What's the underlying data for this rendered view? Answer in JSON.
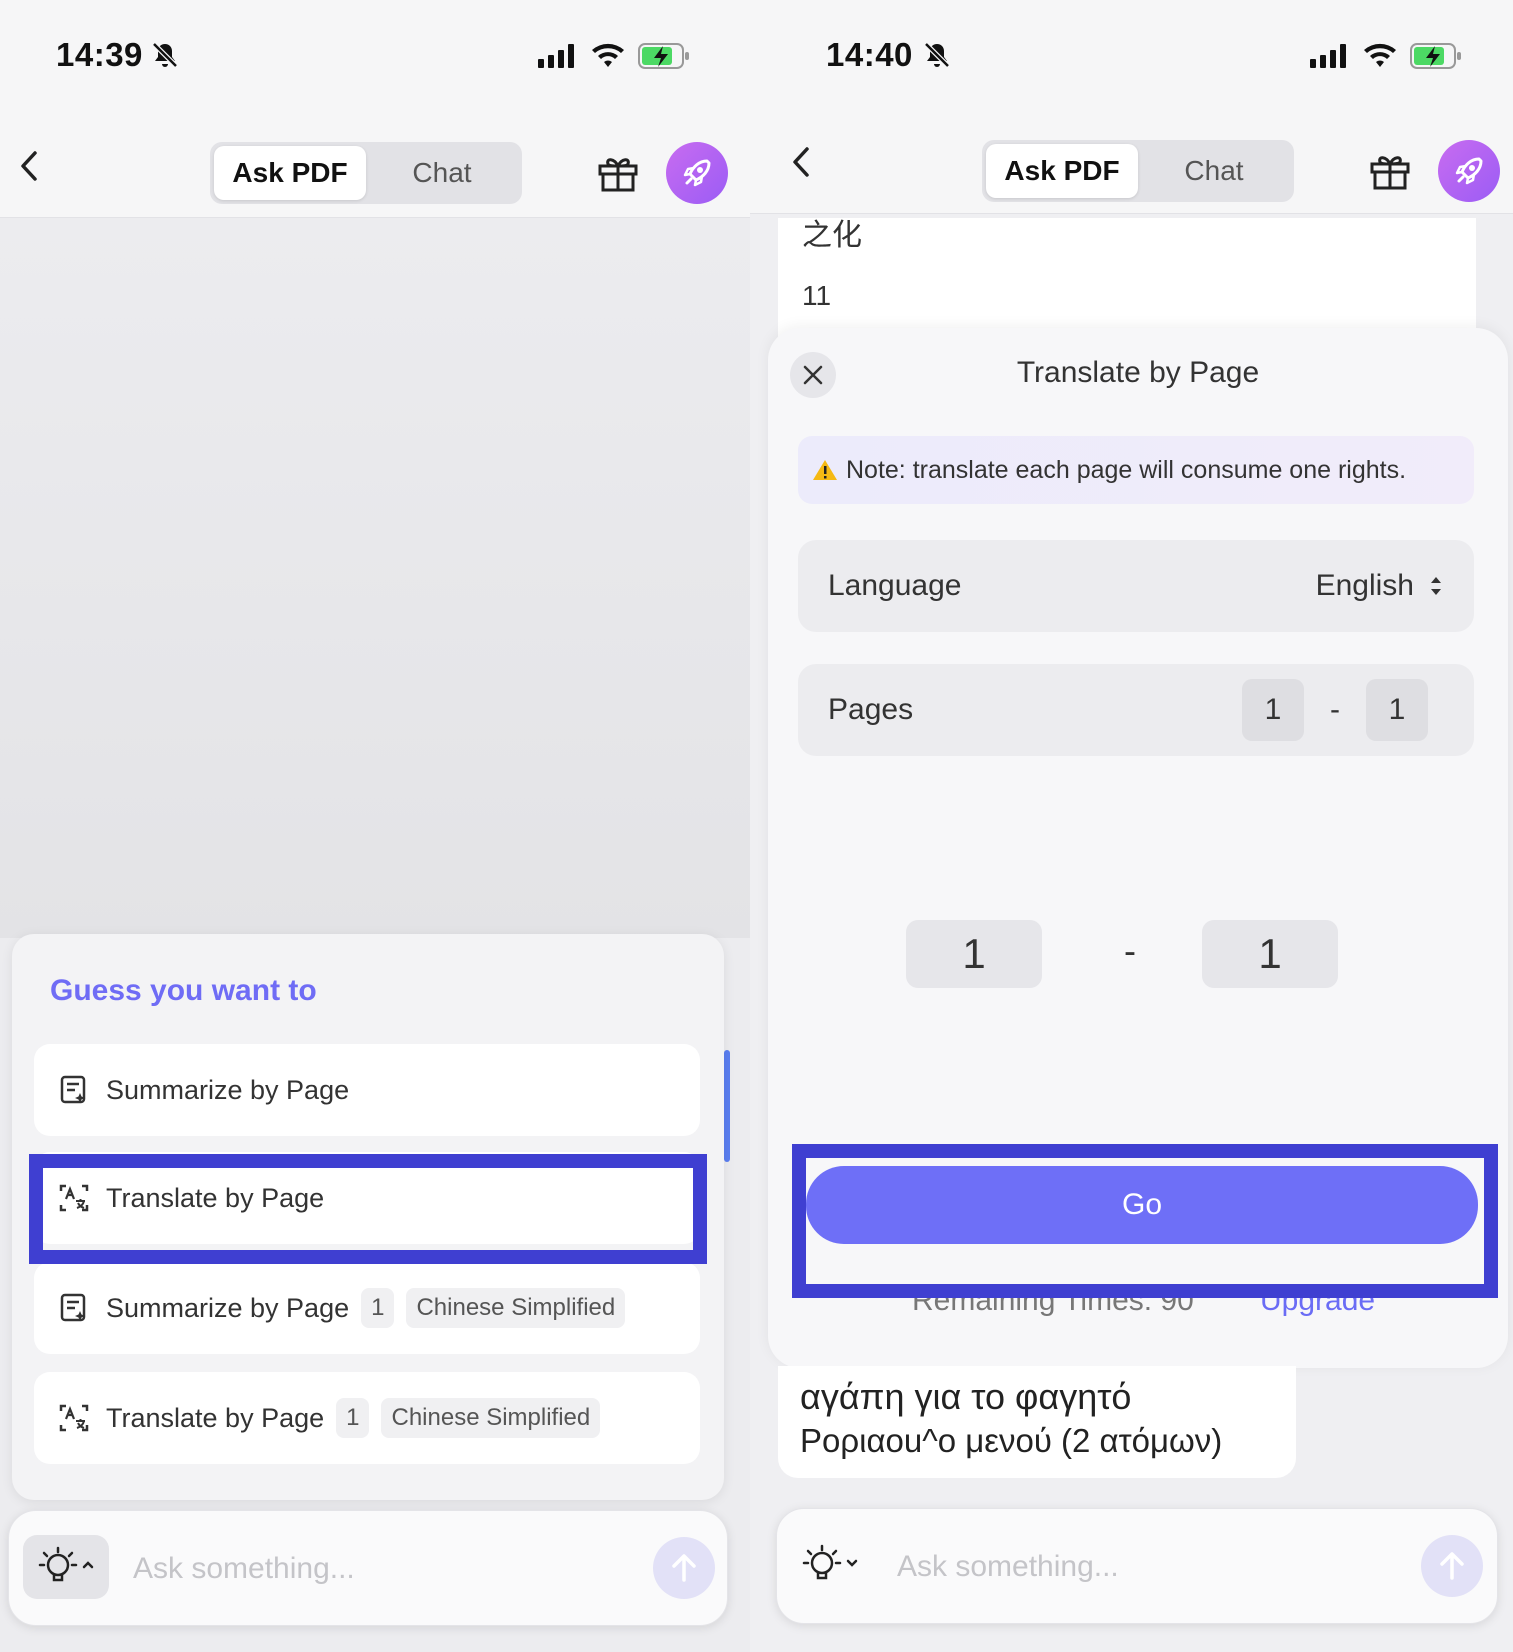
{
  "left": {
    "status": {
      "time": "14:39"
    },
    "header": {
      "tabs": [
        "Ask PDF",
        "Chat"
      ],
      "active_tab": "Ask PDF"
    },
    "suggestions": {
      "title": "Guess you want to",
      "items": [
        {
          "label": "Summarize by Page",
          "icon": "summarize-icon"
        },
        {
          "label": "Translate by Page",
          "icon": "translate-icon",
          "highlighted": true
        },
        {
          "label": "Summarize by Page",
          "icon": "summarize-icon",
          "page": "1",
          "language": "Chinese Simplified"
        },
        {
          "label": "Translate by Page",
          "icon": "translate-icon",
          "page": "1",
          "language": "Chinese Simplified"
        }
      ]
    },
    "input": {
      "placeholder": "Ask something..."
    }
  },
  "right": {
    "status": {
      "time": "14:40"
    },
    "header": {
      "tabs": [
        "Ask PDF",
        "Chat"
      ],
      "active_tab": "Ask PDF"
    },
    "document": {
      "top_text": "之化",
      "number": "11"
    },
    "modal": {
      "title": "Translate by Page",
      "note": "Note: translate each page will consume one rights.",
      "language_label": "Language",
      "language_value": "English",
      "pages_label": "Pages",
      "page_from": "1",
      "page_to": "1",
      "page_separator": "-",
      "picker_from": "1",
      "picker_to": "1",
      "picker_separator": "-",
      "go_label": "Go",
      "remaining": "Remaining Times: 90",
      "upgrade": "Upgrade"
    },
    "greek_text": {
      "line1": "αγάπη για το φαγητό",
      "line2": "Ροριαοu^ο μενού (2 ατόμων)"
    },
    "input": {
      "placeholder": "Ask something..."
    }
  },
  "colors": {
    "accent": "#6f6cf5",
    "go_button": "#6e6ff7",
    "highlight_border": "#3f3fd1",
    "rocket_gradient": [
      "#c86cf0",
      "#9b5cf5"
    ],
    "battery_green": "#4cd964"
  }
}
